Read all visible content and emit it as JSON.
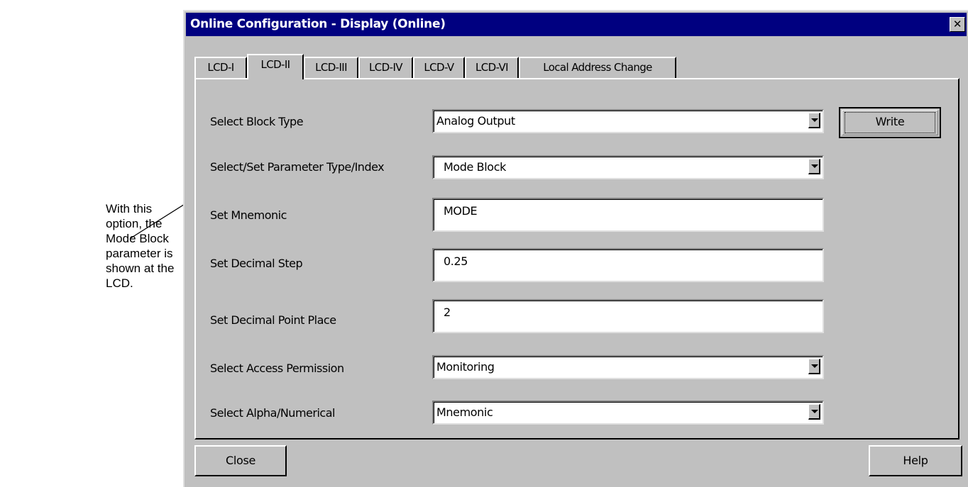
{
  "annotation": {
    "text": "With this\noption, the\nMode Block\nparameter is\nshown at the\nLCD."
  },
  "window": {
    "title": "Online Configuration - Display  (Online)",
    "close_glyph": "✕"
  },
  "tabs": [
    {
      "label": "LCD-I",
      "active": false
    },
    {
      "label": "LCD-II",
      "active": true
    },
    {
      "label": "LCD-III",
      "active": false
    },
    {
      "label": "LCD-IV",
      "active": false
    },
    {
      "label": "LCD-V",
      "active": false
    },
    {
      "label": "LCD-VI",
      "active": false
    },
    {
      "label": "Local Address Change",
      "active": false
    }
  ],
  "form": {
    "block_type": {
      "label": "Select Block Type",
      "value": "Analog Output"
    },
    "parameter": {
      "label": "Select/Set Parameter Type/Index",
      "value": "Mode Block"
    },
    "mnemonic": {
      "label": "Set Mnemonic",
      "value": "MODE"
    },
    "decimal_step": {
      "label": "Set Decimal Step",
      "value": "0.25"
    },
    "decimal_point": {
      "label": "Set Decimal Point Place",
      "value": "2"
    },
    "access": {
      "label": "Select Access Permission",
      "value": "Monitoring"
    },
    "alpha": {
      "label": "Select Alpha/Numerical",
      "value": "Mnemonic"
    }
  },
  "buttons": {
    "write": "Write",
    "close": "Close",
    "help": "Help"
  },
  "icons": {
    "dropdown": "chevron-down-icon",
    "close": "close-icon"
  },
  "colors": {
    "titlebar": "#000080",
    "face": "#c0c0c0"
  }
}
